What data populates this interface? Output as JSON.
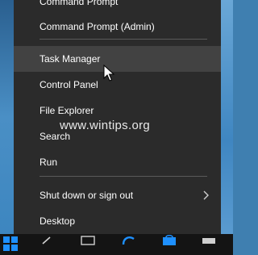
{
  "menu": {
    "items": [
      {
        "label": "Command Prompt",
        "hover": false
      },
      {
        "label": "Command Prompt (Admin)",
        "hover": false
      },
      {
        "label": "Task Manager",
        "hover": true
      },
      {
        "label": "Control Panel",
        "hover": false
      },
      {
        "label": "File Explorer",
        "hover": false
      },
      {
        "label": "Search",
        "hover": false
      },
      {
        "label": "Run",
        "hover": false
      },
      {
        "label": "Shut down or sign out",
        "hover": false,
        "submenu": true
      },
      {
        "label": "Desktop",
        "hover": false
      }
    ]
  },
  "watermark": "www.wintips.org",
  "colors": {
    "menu_bg": "#2b2b2b",
    "hover_bg": "#424242",
    "separator": "#5a5a5a",
    "taskbar": "#141414",
    "accent": "#1e90ff"
  },
  "taskbar": {
    "icons": [
      "windows-start-icon",
      "search-icon",
      "task-view-icon",
      "edge-icon",
      "store-icon",
      "system-tray-icon"
    ]
  }
}
